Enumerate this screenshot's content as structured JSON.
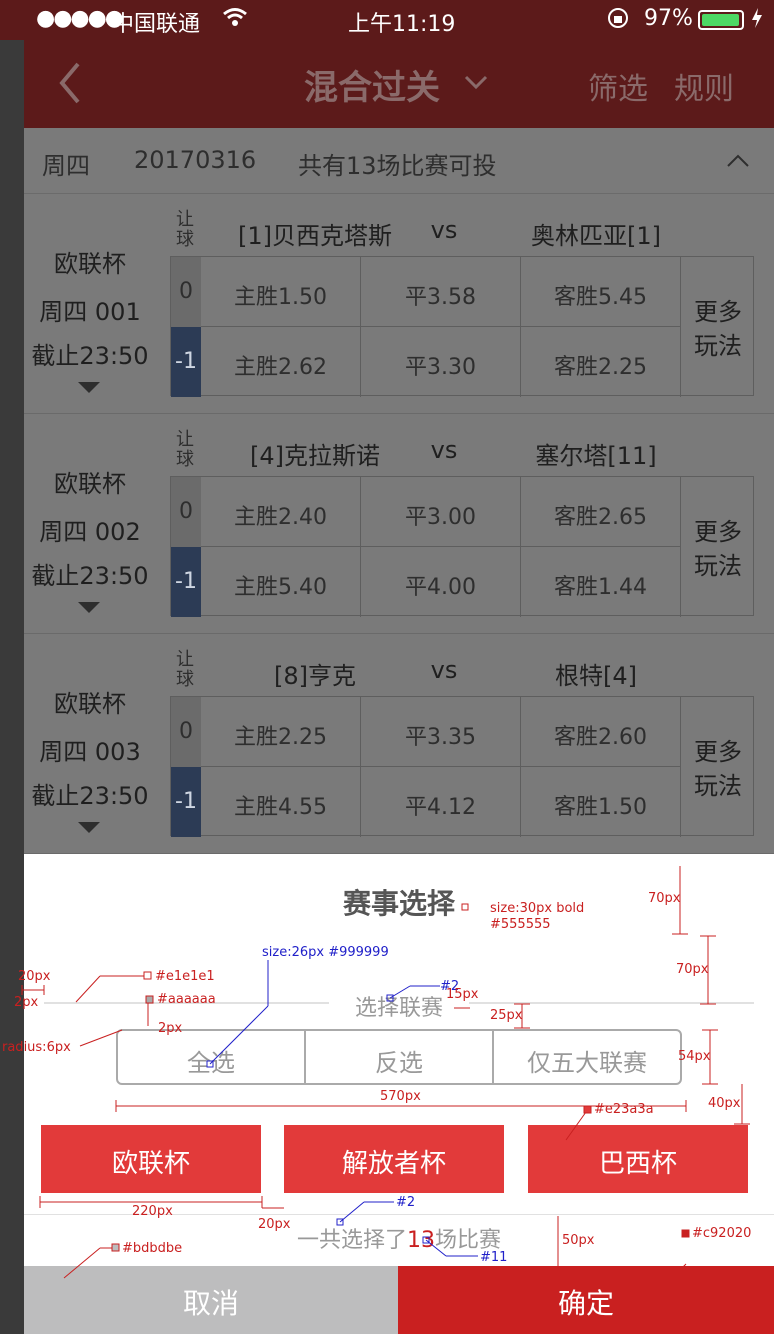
{
  "status": {
    "dots": "●●●●●",
    "carrier": "中国联通",
    "time": "上午11:19",
    "battery": "97%"
  },
  "nav": {
    "title": "混合过关",
    "filter": "筛选",
    "rules": "规则"
  },
  "datebar": {
    "day": "周四",
    "date": "20170316",
    "summary": "共有13场比赛可投"
  },
  "matches": [
    {
      "league": "欧联杯",
      "num": "周四 001",
      "deadline": "截止23:50",
      "rq": "让球",
      "home": "[1]贝西克塔斯",
      "vs": "vs",
      "away": "奥林匹亚[1]",
      "hc0": "0",
      "hc1": "-1",
      "more": "更多玩法",
      "r0": [
        "主胜1.50",
        "平3.58",
        "客胜5.45"
      ],
      "r1": [
        "主胜2.62",
        "平3.30",
        "客胜2.25"
      ]
    },
    {
      "league": "欧联杯",
      "num": "周四 002",
      "deadline": "截止23:50",
      "rq": "让球",
      "home": "[4]克拉斯诺",
      "vs": "vs",
      "away": "塞尔塔[11]",
      "hc0": "0",
      "hc1": "-1",
      "more": "更多玩法",
      "r0": [
        "主胜2.40",
        "平3.00",
        "客胜2.65"
      ],
      "r1": [
        "主胜5.40",
        "平4.00",
        "客胜1.44"
      ]
    },
    {
      "league": "欧联杯",
      "num": "周四 003",
      "deadline": "截止23:50",
      "rq": "让球",
      "home": "[8]亨克",
      "vs": "vs",
      "away": "根特[4]",
      "hc0": "0",
      "hc1": "-1",
      "more": "更多玩法",
      "r0": [
        "主胜2.25",
        "平3.35",
        "客胜2.60"
      ],
      "r1": [
        "主胜4.55",
        "平4.12",
        "客胜1.50"
      ]
    }
  ],
  "sheet": {
    "title": "赛事选择",
    "league_label": "选择联赛",
    "segments": [
      "全选",
      "反选",
      "仅五大联赛"
    ],
    "leagues": [
      "欧联杯",
      "解放者杯",
      "巴西杯"
    ],
    "summary_prefix": "一共选择了",
    "summary_count": "13",
    "summary_suffix": "场比赛",
    "cancel": "取消",
    "confirm": "确定"
  },
  "annotations": {
    "title_size": "size:30px bold",
    "title_color": "#555555",
    "h70a": "70px",
    "h70b": "70px",
    "label_size": "size:26px #999999",
    "w20a": "20px",
    "c_e1e1e1": "#e1e1e1",
    "h2a": "2px",
    "c_aaaaaa": "#aaaaaa",
    "h2b": "2px",
    "radius": "radius:6px",
    "n2a": "#2",
    "w15": "15px",
    "h25": "25px",
    "h54": "54px",
    "w570": "570px",
    "h40": "40px",
    "c_e23a3a": "#e23a3a",
    "w220": "220px",
    "w20b": "20px",
    "n2b": "#2",
    "n11": "#11",
    "h50": "50px",
    "c_bdbdbe": "#bdbdbe",
    "c_c92020": "#c92020"
  },
  "colors": {
    "accent": "#e23a3a",
    "confirm": "#c92020",
    "cancel": "#bdbdbe",
    "title": "#555555",
    "label": "#999999",
    "divider": "#e1e1e1",
    "border": "#aaaaaa"
  }
}
